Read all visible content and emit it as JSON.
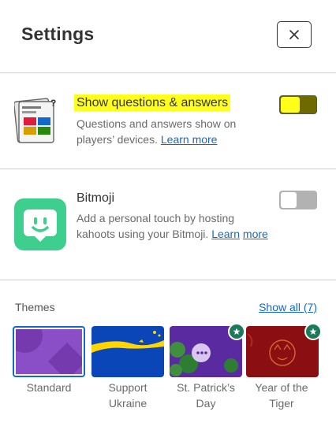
{
  "header": {
    "title": "Settings",
    "close_icon": "close-icon"
  },
  "settings": [
    {
      "title": "Show questions & answers",
      "desc": "Questions and answers show on players’ devices.",
      "link": "Learn more",
      "toggle_on": true,
      "icon": "questions-answers-icon"
    },
    {
      "title": "Bitmoji",
      "desc": "Add a personal touch by hosting kahoots using your Bitmoji.",
      "link_part1": "Learn",
      "link_part2": "more",
      "toggle_on": false,
      "icon": "bitmoji-icon"
    }
  ],
  "themes": {
    "label": "Themes",
    "show_all": "Show all (7)",
    "items": [
      {
        "line1": "Standard",
        "line2": "",
        "selected": true,
        "premium": false
      },
      {
        "line1": "Support",
        "line2": "Ukraine",
        "selected": false,
        "premium": false
      },
      {
        "line1": "St. Patrick’s",
        "line2": "Day",
        "selected": false,
        "premium": true
      },
      {
        "line1": "Year of the",
        "line2": "Tiger",
        "selected": false,
        "premium": true
      }
    ]
  },
  "colors": {
    "accent_link": "#1368ce",
    "highlight": "#ffff1a",
    "bitmoji_green": "#3ecf8e",
    "premium_badge": "#1b7a5a"
  }
}
